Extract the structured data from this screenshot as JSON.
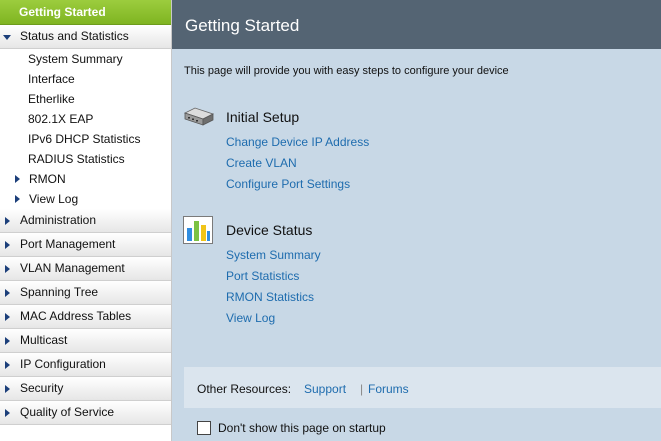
{
  "sidebar": {
    "active_item": "Getting Started",
    "status_section": "Status and Statistics",
    "status_children": [
      "System Summary",
      "Interface",
      "Etherlike",
      "802.1X EAP",
      "IPv6 DHCP Statistics",
      "RADIUS Statistics"
    ],
    "rmon": "RMON",
    "view_log": "View Log",
    "sections": [
      "Administration",
      "Port Management",
      "VLAN Management",
      "Spanning Tree",
      "MAC Address Tables",
      "Multicast",
      "IP Configuration",
      "Security",
      "Quality of Service"
    ]
  },
  "header": {
    "title": "Getting Started"
  },
  "intro": "This page will provide you with easy steps to configure your device",
  "initial_setup": {
    "title": "Initial Setup",
    "icon": "device-icon",
    "links": [
      "Change Device IP Address",
      "Create VLAN",
      "Configure Port Settings"
    ]
  },
  "device_status": {
    "title": "Device Status",
    "icon": "bar-chart-icon",
    "links": [
      "System Summary",
      "Port Statistics",
      "RMON Statistics",
      "View Log"
    ]
  },
  "resources": {
    "label": "Other Resources:",
    "support": "Support",
    "separator": "|",
    "forums": "Forums"
  },
  "startup": {
    "label": "Don't show this page on startup",
    "checked": false
  },
  "colors": {
    "active_nav": "#8ac22f",
    "header_bg": "#546473",
    "content_bg": "#c8d8e6",
    "link": "#1e6cae"
  }
}
